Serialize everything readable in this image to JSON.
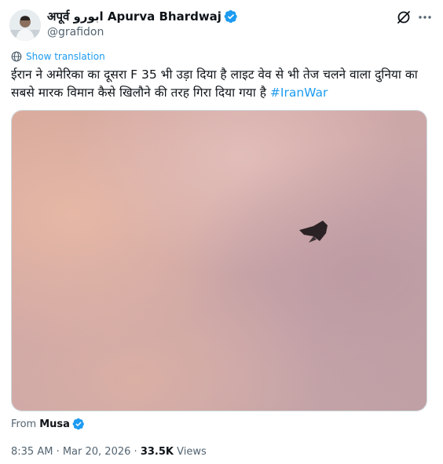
{
  "author": {
    "display_name": "अपूर्व ابورو Apurva Bhardwaj",
    "handle": "@grafidon",
    "verified_icon": "verified-badge-icon",
    "avatar_icon": "profile-avatar"
  },
  "actions": {
    "grok_icon": "grok-slash-icon",
    "more_icon": "more-options-icon"
  },
  "translate": {
    "icon": "globe-icon",
    "label": "Show translation"
  },
  "tweet": {
    "text": "ईरान ने अमेरिका का दूसरा F 35 भी उड़ा दिया है लाइट वेव से भी तेज चलने वाला दुनिया का सबसे मारक विमान कैसे खिलौने की तरह गिरा दिया गया है ",
    "hashtag": "#IranWar"
  },
  "media": {
    "type": "video-still",
    "subject": "fighter-jet-silhouette"
  },
  "source": {
    "prefix": "From",
    "name": "Musa",
    "verified_icon": "verified-badge-icon"
  },
  "meta": {
    "time": "8:35 AM",
    "separator": " · ",
    "date": "Mar 20, 2026",
    "views_count": "33.5K",
    "views_label": " Views"
  },
  "colors": {
    "accent": "#1d9bf0",
    "text": "#0f1419",
    "secondary": "#536471",
    "border": "#cfd9de"
  }
}
